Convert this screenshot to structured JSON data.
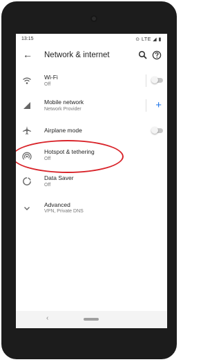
{
  "status_bar": {
    "time": "13:15",
    "indicators": "⊙ LTE ◢ ▮"
  },
  "app_bar": {
    "title": "Network & internet",
    "back_icon": "arrow-back-icon",
    "search_icon": "search-icon",
    "help_icon": "help-icon"
  },
  "settings": [
    {
      "label": "Wi-Fi",
      "sub": "Off",
      "icon": "wifi-icon",
      "control": "toggle",
      "on": false
    },
    {
      "label": "Mobile network",
      "sub": "Network Provider",
      "icon": "signal-icon",
      "control": "add"
    },
    {
      "label": "Airplane mode",
      "sub": "",
      "icon": "airplane-icon",
      "control": "toggle",
      "on": false
    },
    {
      "label": "Hotspot & tethering",
      "sub": "Off",
      "icon": "hotspot-icon",
      "control": "none"
    },
    {
      "label": "Data Saver",
      "sub": "Off",
      "icon": "data-saver-icon",
      "control": "none"
    },
    {
      "label": "Advanced",
      "sub": "VPN, Private DNS",
      "icon": "chevron-down-icon",
      "control": "none"
    }
  ],
  "plus_symbol": "+",
  "navigation_bar": {
    "back_glyph": "‹"
  },
  "colors": {
    "accent": "#1a73e8",
    "highlight_circle": "#d9242a"
  }
}
